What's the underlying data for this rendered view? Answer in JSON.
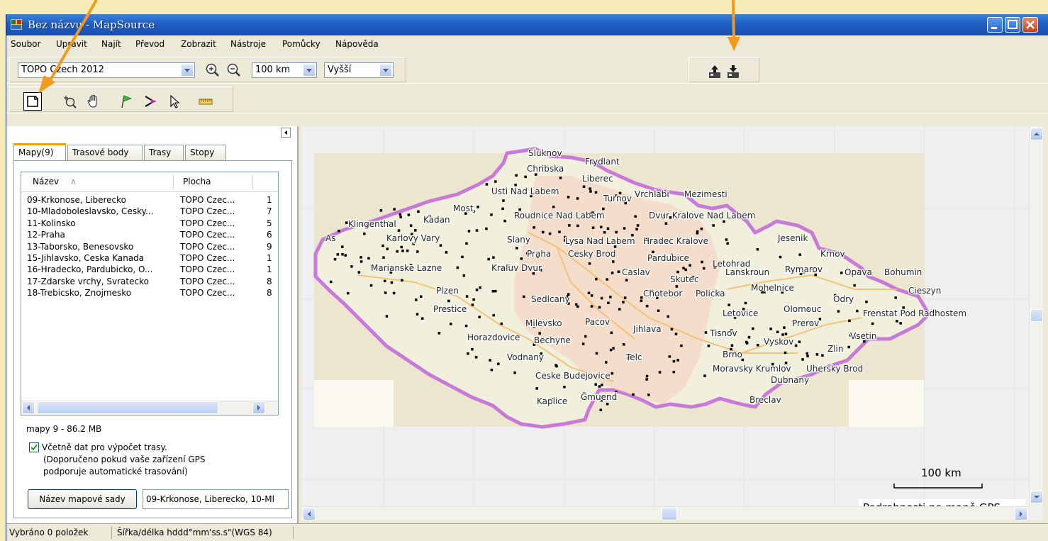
{
  "window": {
    "title": "Bez názvu - MapSource"
  },
  "menu": [
    "Soubor",
    "Upravit",
    "Najít",
    "Převod",
    "Zobrazit",
    "Nástroje",
    "Pomůcky",
    "Nápověda"
  ],
  "toolbar": {
    "map_product": "TOPO Czech 2012",
    "zoom_level": "100 km",
    "detail_level": "Vyšší"
  },
  "panel": {
    "tabs": [
      "Mapy(9)",
      "Trasové body",
      "Trasy",
      "Stopy"
    ],
    "active_tab": "Mapy(9)",
    "columns": [
      "Název",
      "Plocha"
    ],
    "rows": [
      {
        "name": "09-Krkonose, Liberecko",
        "area": "TOPO Czec...",
        "extra": "1"
      },
      {
        "name": "10-Mladoboleslavsko, Cesky...",
        "area": "TOPO Czec...",
        "extra": "7"
      },
      {
        "name": "11-Kolinsko",
        "area": "TOPO Czec...",
        "extra": "5"
      },
      {
        "name": "12-Praha",
        "area": "TOPO Czec...",
        "extra": "6"
      },
      {
        "name": "13-Taborsko, Benesovsko",
        "area": "TOPO Czec...",
        "extra": "9"
      },
      {
        "name": "15-Jihlavsko, Ceska Kanada",
        "area": "TOPO Czec...",
        "extra": "1"
      },
      {
        "name": "16-Hradecko, Pardubicko, O...",
        "area": "TOPO Czec...",
        "extra": "1"
      },
      {
        "name": "17-Zdarske vrchy, Svratecko",
        "area": "TOPO Czec...",
        "extra": "8"
      },
      {
        "name": "18-Trebicsko, Znojmesko",
        "area": "TOPO Czec...",
        "extra": "8"
      }
    ],
    "summary": "mapy 9 - 86.2 MB",
    "checkbox_label": "Včetně dat pro výpočet trasy.",
    "checkbox_note_1": "(Doporučeno pokud vaše zařízení GPS",
    "checkbox_note_2": "podporuje automatické trasování)",
    "mapset_button": "Název mapové sady",
    "mapset_value": "09-Krkonose, Liberecko, 10-Ml"
  },
  "map": {
    "cities": [
      {
        "label": "Sluknov"
      },
      {
        "label": "Chribska"
      },
      {
        "label": "Frydlant"
      },
      {
        "label": "Liberec"
      },
      {
        "label": "Usti Nad Labem"
      },
      {
        "label": "Turnov"
      },
      {
        "label": "Vrchlabi"
      },
      {
        "label": "Mezimesti"
      },
      {
        "label": "Most"
      },
      {
        "label": "Kadan"
      },
      {
        "label": "Roudnice Nad Labem"
      },
      {
        "label": "Dvur Kralove Nad Labem"
      },
      {
        "label": "Klingenthal"
      },
      {
        "label": "As"
      },
      {
        "label": "Karlovy Vary"
      },
      {
        "label": "Slany"
      },
      {
        "label": "Lysa Nad Labem"
      },
      {
        "label": "Hradec Kralove"
      },
      {
        "label": "Jesenik"
      },
      {
        "label": "Praha"
      },
      {
        "label": "Cesky Brod"
      },
      {
        "label": "Pardubice"
      },
      {
        "label": "Letohrad"
      },
      {
        "label": "Krnov"
      },
      {
        "label": "Marianske Lazne"
      },
      {
        "label": "Kraluv Dvur"
      },
      {
        "label": "Caslav"
      },
      {
        "label": "Lanskroun"
      },
      {
        "label": "Rymarov"
      },
      {
        "label": "Opava"
      },
      {
        "label": "Bohumin"
      },
      {
        "label": "Skutec"
      },
      {
        "label": "Plzen"
      },
      {
        "label": "Chotebor"
      },
      {
        "label": "Policka"
      },
      {
        "label": "Mohelnice"
      },
      {
        "label": "Cieszyn"
      },
      {
        "label": "Sedlcany"
      },
      {
        "label": "Odry"
      },
      {
        "label": "Prestice"
      },
      {
        "label": "Letovice"
      },
      {
        "label": "Olomouc"
      },
      {
        "label": "Frenstat Pod Radhostem"
      },
      {
        "label": "Milevsko"
      },
      {
        "label": "Pacov"
      },
      {
        "label": "Prerov"
      },
      {
        "label": "Jihlava"
      },
      {
        "label": "Tisnov"
      },
      {
        "label": "Vsetin"
      },
      {
        "label": "Horazdovice"
      },
      {
        "label": "Bechyne"
      },
      {
        "label": "Vyskov"
      },
      {
        "label": "Zlin"
      },
      {
        "label": "Vodnany"
      },
      {
        "label": "Telc"
      },
      {
        "label": "Brno"
      },
      {
        "label": "Moravsky Krumlov"
      },
      {
        "label": "Uhersky Brod"
      },
      {
        "label": "Ceske Budejovice"
      },
      {
        "label": "Dubnany"
      },
      {
        "label": "Kaplice"
      },
      {
        "label": "Gmuend"
      },
      {
        "label": "Breclav"
      }
    ],
    "scale_label": "100 km",
    "detail_caption": "Podrobnosti na mapě GPS"
  },
  "status": {
    "selection": "Vybráno 0 položek",
    "coords": "Šířka/délka hddd°mm'ss.s\"(WGS 84)"
  }
}
